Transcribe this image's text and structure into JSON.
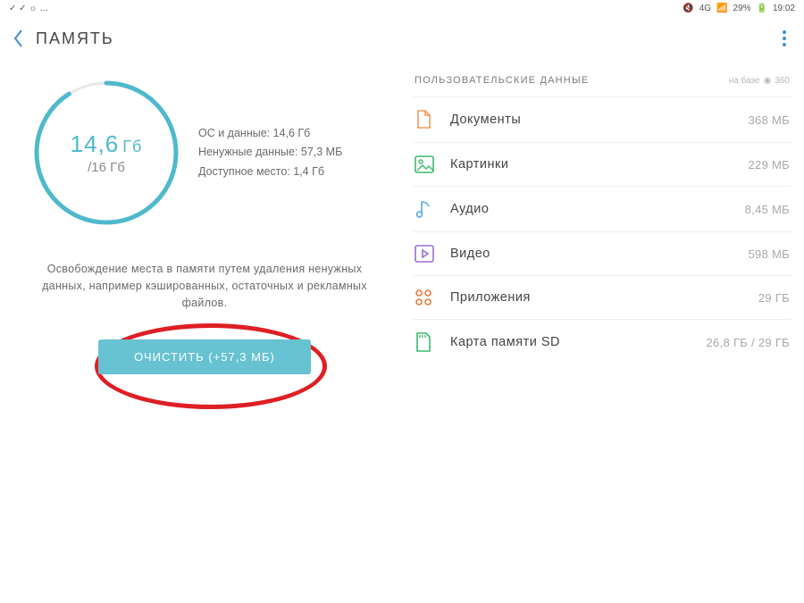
{
  "statusbar": {
    "left": "✓ ✓ ☼ …",
    "right_signal": "4G",
    "right_battery": "29%",
    "right_time": "19:02"
  },
  "header": {
    "title": "ПАМЯТЬ"
  },
  "gauge": {
    "used_value": "14,6",
    "used_unit": "Гб",
    "total": "/16 Гб"
  },
  "stats": {
    "line1": "ОС и данные: 14,6 Гб",
    "line2": "Ненужные данные: 57,3 МБ",
    "line3": "Доступное место: 1,4 Гб"
  },
  "description": "Освобождение места в памяти путем удаления ненужных данных, например кэшированных, остаточных и рекламных файлов.",
  "clean_button": "ОЧИСТИТЬ (+57,3 МБ)",
  "user_data": {
    "heading": "ПОЛЬЗОВАТЕЛЬСКИЕ ДАННЫЕ",
    "brand_prefix": "на базе",
    "brand_name": "360"
  },
  "categories": [
    {
      "label": "Документы",
      "value": "368 МБ"
    },
    {
      "label": "Картинки",
      "value": "229 МБ"
    },
    {
      "label": "Аудио",
      "value": "8,45 МБ"
    },
    {
      "label": "Видео",
      "value": "598 МБ"
    },
    {
      "label": "Приложения",
      "value": "29 ГБ"
    },
    {
      "label": "Карта памяти SD",
      "value": "26,8 ГБ / 29 ГБ"
    }
  ]
}
